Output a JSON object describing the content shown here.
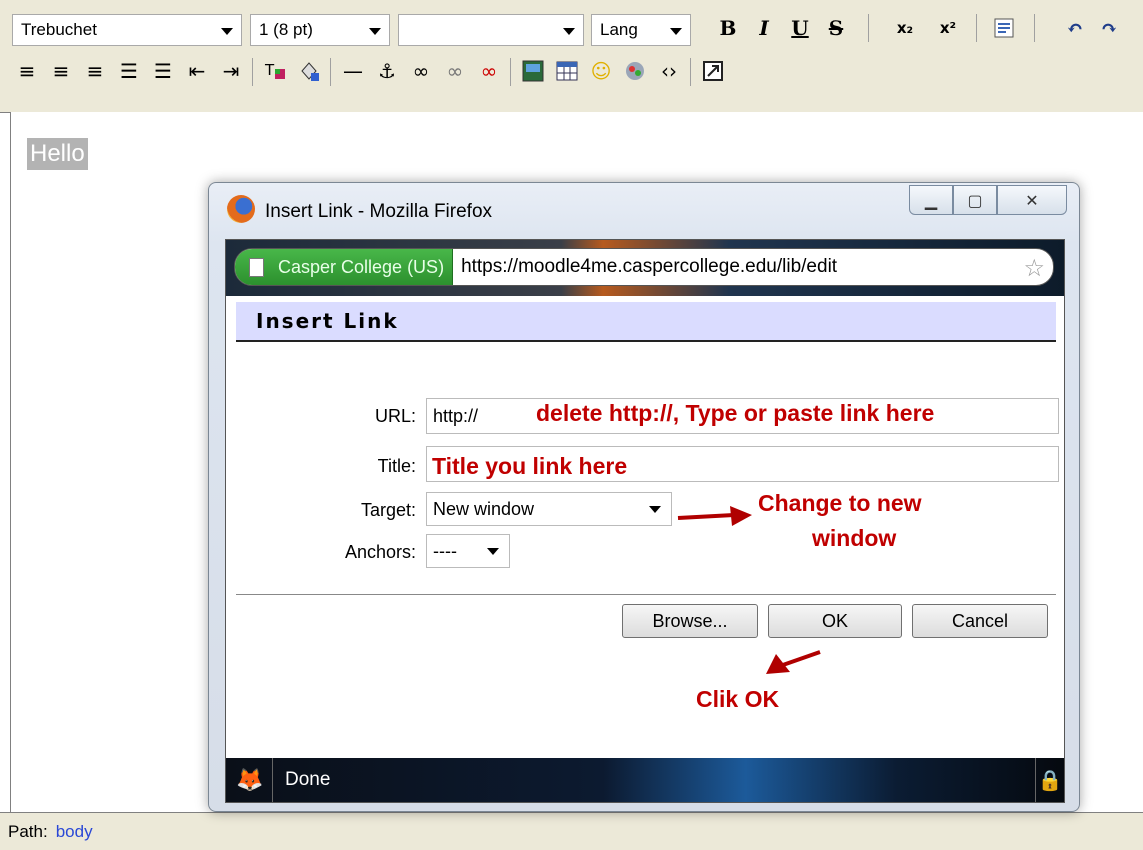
{
  "toolbar": {
    "font_family": "Trebuchet",
    "font_size": "1 (8 pt)",
    "format_value": "",
    "lang_label": "Lang",
    "bold": "B",
    "italic": "I",
    "underline": "U",
    "strike": "S",
    "subscript": "x₂",
    "superscript": "x²"
  },
  "editor": {
    "content_text": "Hello",
    "path_label": "Path:",
    "path_value": "body"
  },
  "dialog": {
    "window_title": "Insert Link - Mozilla Firefox",
    "identity_label": "Casper College (US)",
    "url": "https://moodle4me.caspercollege.edu/lib/edit",
    "header": "Insert Link",
    "url_label": "URL:",
    "url_value": "http://",
    "title_label": "Title:",
    "title_value": "",
    "target_label": "Target:",
    "target_value": "New window",
    "anchors_label": "Anchors:",
    "anchors_value": "----",
    "browse_button": "Browse...",
    "ok_button": "OK",
    "cancel_button": "Cancel",
    "status_text": "Done"
  },
  "annotations": {
    "url_note": "delete http://, Type or paste link here",
    "title_note": "Title you link here",
    "target_note_line1": "Change to new",
    "target_note_line2": "window",
    "ok_note": "Clik OK",
    "color": "#c00000"
  }
}
